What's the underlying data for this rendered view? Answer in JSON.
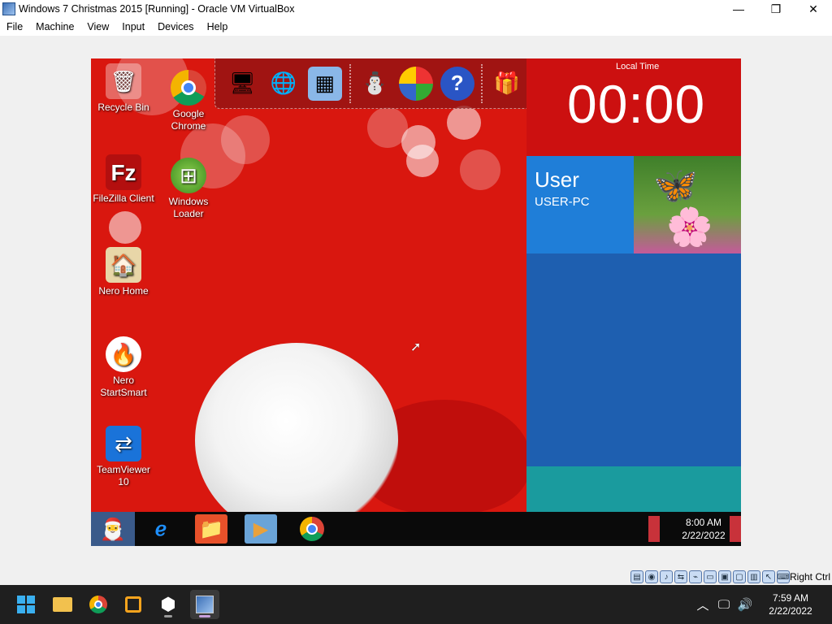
{
  "window": {
    "title": "Windows 7 Christmas 2015 [Running] - Oracle VM VirtualBox",
    "minimize_glyph": "—",
    "restore_glyph": "❐",
    "close_glyph": "✕"
  },
  "menu": [
    "File",
    "Machine",
    "View",
    "Input",
    "Devices",
    "Help"
  ],
  "guest": {
    "desktop_icons": [
      {
        "label": "Recycle Bin",
        "icon": "recycle-bin-icon"
      },
      {
        "label": "Google\nChrome",
        "icon": "chrome-icon"
      },
      {
        "label": "FileZilla Client",
        "icon": "filezilla-icon"
      },
      {
        "label": "Windows\nLoader",
        "icon": "windows-loader-icon"
      },
      {
        "label": "Nero Home",
        "icon": "nero-home-icon"
      },
      {
        "label": "Nero\nStartSmart",
        "icon": "nero-startsmart-icon"
      },
      {
        "label": "TeamViewer\n10",
        "icon": "teamviewer-icon"
      }
    ],
    "clock_tile": {
      "label": "Local Time",
      "time": "00:00"
    },
    "user_tile": {
      "name": "User",
      "pc": "USER-PC"
    },
    "taskbar": {
      "time": "8:00 AM",
      "date": "2/22/2022"
    }
  },
  "statusbar": {
    "host_key": "Right Ctrl"
  },
  "host": {
    "time": "7:59 AM",
    "date": "2/22/2022"
  },
  "colors": {
    "guest_background": "#d9170f",
    "metro_blue": "#1e5fb0",
    "metro_teal": "#1a9b9e"
  }
}
